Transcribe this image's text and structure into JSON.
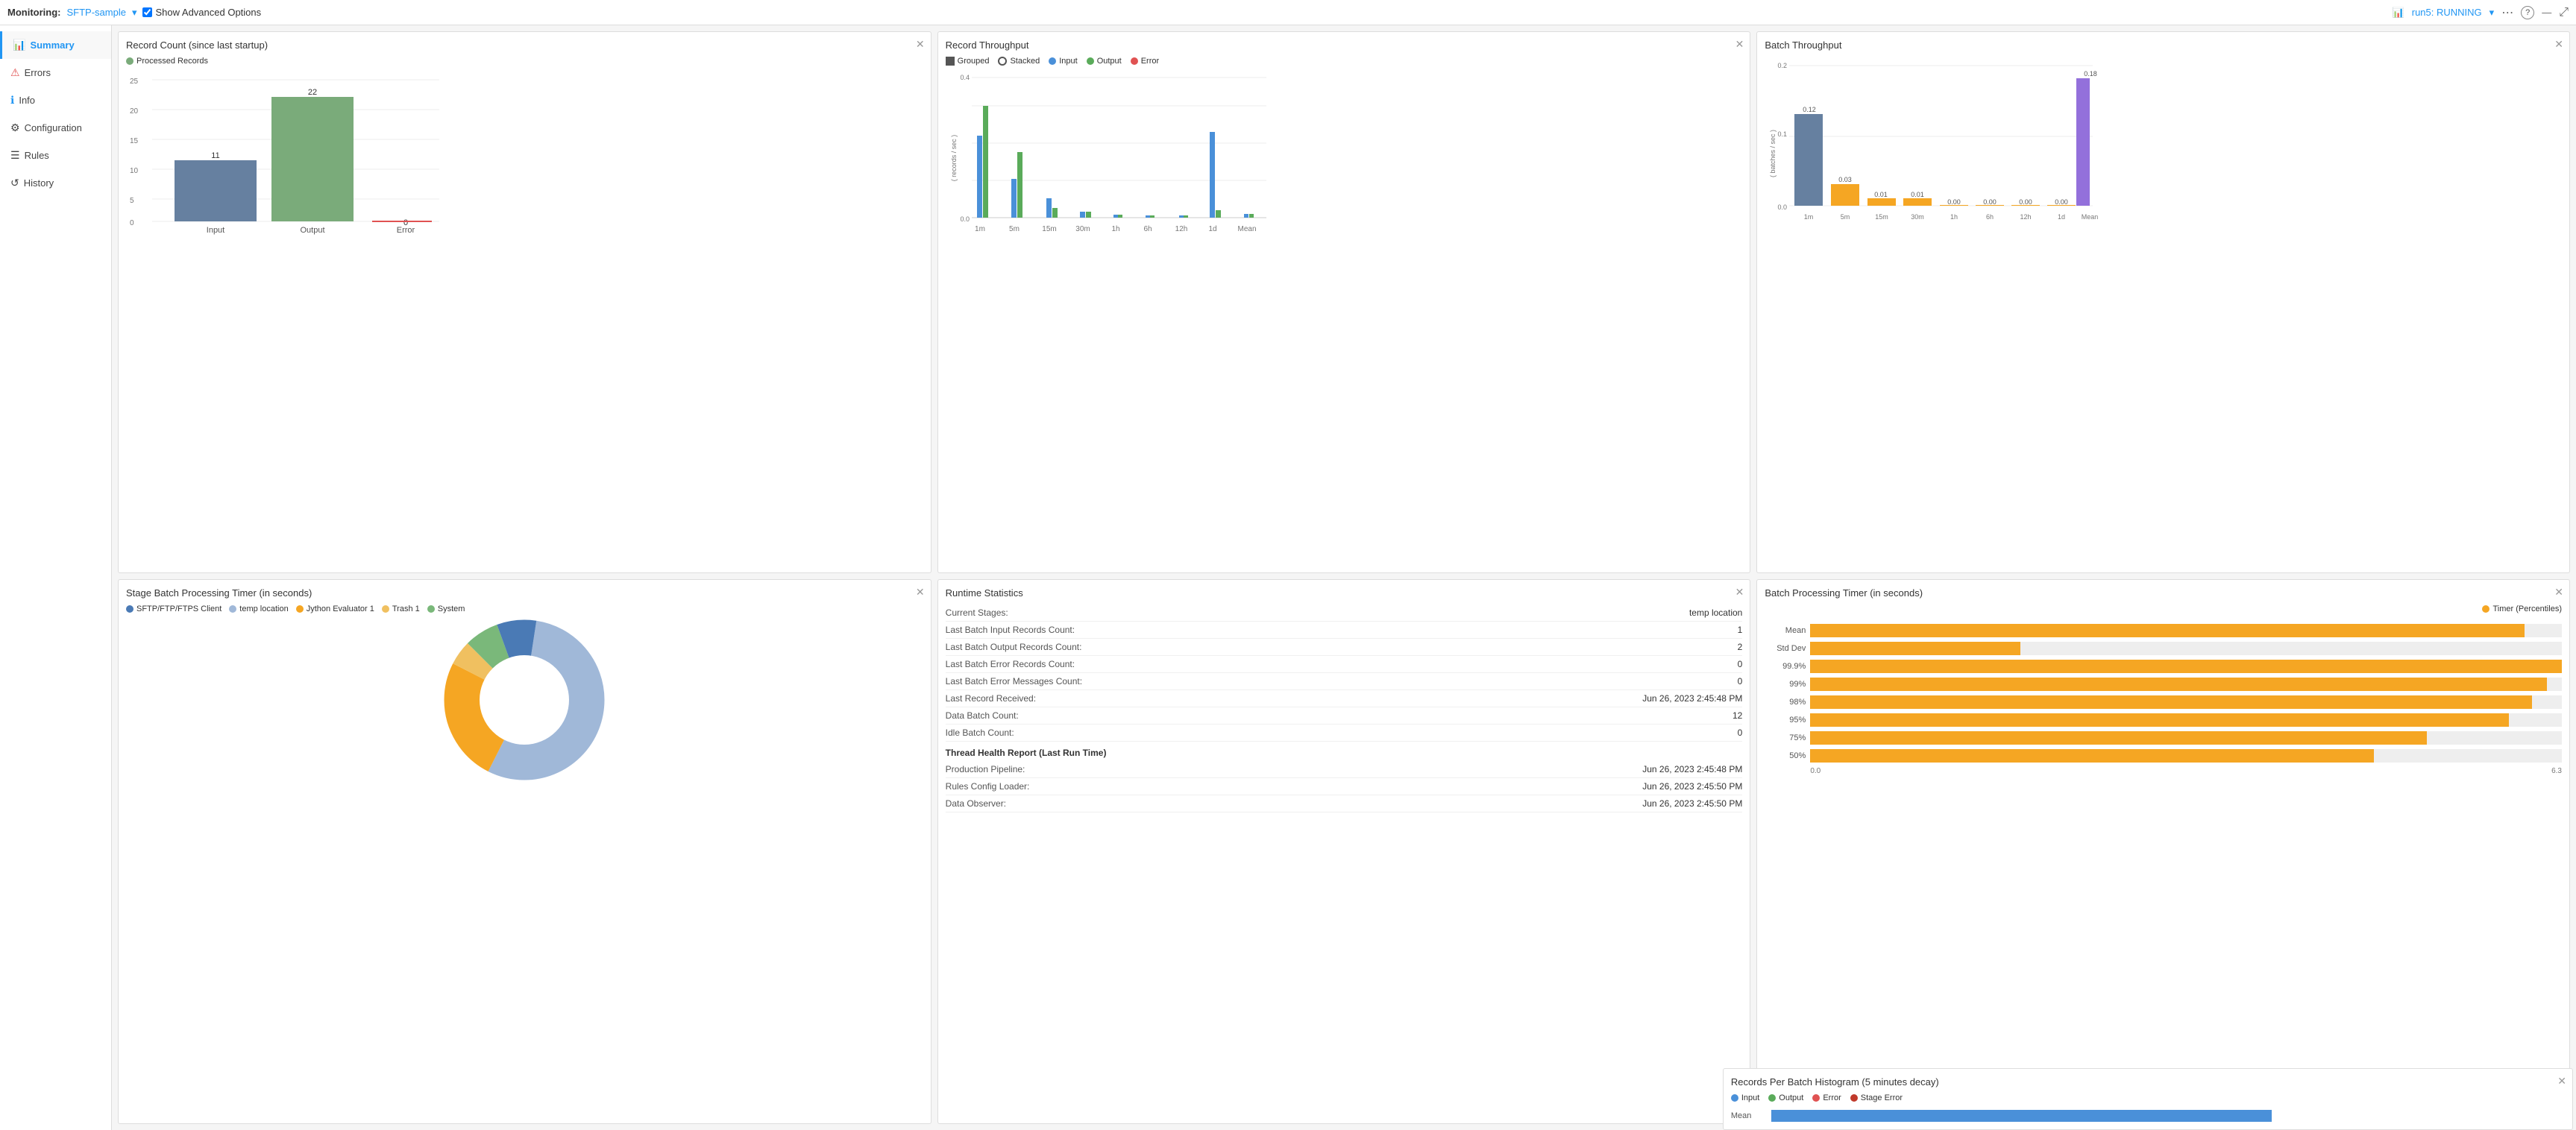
{
  "topbar": {
    "monitoring": "Monitoring:",
    "sftp_label": "SFTP-sample",
    "show_advanced": "Show Advanced Options",
    "run_label": "run5: RUNNING",
    "more_icon": "⋯",
    "help_icon": "?",
    "minimize_icon": "—",
    "maximize_icon": "⤢"
  },
  "sidebar": {
    "items": [
      {
        "id": "summary",
        "label": "Summary",
        "icon": "📊",
        "active": true
      },
      {
        "id": "errors",
        "label": "Errors",
        "icon": "⚠",
        "active": false
      },
      {
        "id": "info",
        "label": "Info",
        "icon": "ℹ",
        "active": false
      },
      {
        "id": "configuration",
        "label": "Configuration",
        "icon": "⚙",
        "active": false
      },
      {
        "id": "rules",
        "label": "Rules",
        "icon": "☰",
        "active": false
      },
      {
        "id": "history",
        "label": "History",
        "icon": "↺",
        "active": false
      }
    ]
  },
  "panels": {
    "record_count": {
      "title": "Record Count (since last startup)",
      "legend": [
        {
          "label": "Processed Records",
          "color": "#5b8a5b"
        }
      ],
      "bars": [
        {
          "label": "Input",
          "value": 11,
          "color": "#6680a0"
        },
        {
          "label": "Output",
          "value": 22,
          "color": "#7aab7a"
        },
        {
          "label": "Error",
          "value": 0,
          "color": "#e05252"
        }
      ]
    },
    "record_throughput": {
      "title": "Record Throughput",
      "y_label": "( records / sec )",
      "legend": [
        {
          "label": "Grouped",
          "type": "filled",
          "color": "#555"
        },
        {
          "label": "Stacked",
          "type": "circle",
          "color": "#555"
        },
        {
          "label": "Input",
          "type": "dot",
          "color": "#4a90d9"
        },
        {
          "label": "Output",
          "type": "dot",
          "color": "#5aab5a"
        },
        {
          "label": "Error",
          "type": "dot",
          "color": "#e05252"
        }
      ],
      "x_labels": [
        "1m",
        "5m",
        "15m",
        "30m",
        "1h",
        "6h",
        "12h",
        "1d",
        "Mean"
      ],
      "y_labels": [
        "0.4",
        "0.0"
      ],
      "data": [
        {
          "x": "1m",
          "input": 55,
          "output": 75
        },
        {
          "x": "5m",
          "input": 20,
          "output": 35
        },
        {
          "x": "15m",
          "input": 10,
          "output": 5
        },
        {
          "x": "30m",
          "input": 3,
          "output": 3
        },
        {
          "x": "1h",
          "input": 2,
          "output": 2
        },
        {
          "x": "6h",
          "input": 1,
          "output": 1
        },
        {
          "x": "12h",
          "input": 1,
          "output": 1
        },
        {
          "x": "1d",
          "input": 45,
          "output": 5
        },
        {
          "x": "Mean",
          "input": 2,
          "output": 2
        }
      ]
    },
    "batch_throughput": {
      "title": "Batch Throughput",
      "y_label": "( batches / sec )",
      "x_labels": [
        "1m",
        "5m",
        "15m",
        "30m",
        "1h",
        "6h",
        "12h",
        "1d",
        "Mean"
      ],
      "values": [
        {
          "x": "1m",
          "v": 0.12,
          "h": 85
        },
        {
          "x": "5m",
          "v": 0.03,
          "h": 21
        },
        {
          "x": "15m",
          "v": 0.01,
          "h": 7
        },
        {
          "x": "30m",
          "v": 0.01,
          "h": 7
        },
        {
          "x": "1h",
          "v": 0.0,
          "h": 1
        },
        {
          "x": "6h",
          "v": 0.0,
          "h": 1
        },
        {
          "x": "12h",
          "v": 0.0,
          "h": 1
        },
        {
          "x": "1d",
          "v": 0.0,
          "h": 1
        },
        {
          "x": "Mean",
          "v": 0.18,
          "h": 127
        }
      ],
      "y_max": "0.2",
      "y_labels": [
        "0.2",
        "0.1",
        "0.0"
      ]
    },
    "stage_batch": {
      "title": "Stage Batch Processing Timer (in seconds)",
      "legend": [
        {
          "label": "SFTP/FTP/FTPS Client",
          "color": "#4a7ab5"
        },
        {
          "label": "temp location",
          "color": "#a0b8d8"
        },
        {
          "label": "Jython Evaluator 1",
          "color": "#f5a623"
        },
        {
          "label": "Trash 1",
          "color": "#f0c060"
        },
        {
          "label": "System",
          "color": "#7ab87a"
        }
      ],
      "donut": {
        "segments": [
          {
            "label": "SFTP/FTP/FTPS Client",
            "color": "#4a7ab5",
            "pct": 8
          },
          {
            "label": "temp location",
            "color": "#a0b8d8",
            "pct": 55
          },
          {
            "label": "Jython Evaluator 1",
            "color": "#f5a623",
            "pct": 25
          },
          {
            "label": "Trash 1",
            "color": "#f0c060",
            "pct": 5
          },
          {
            "label": "System",
            "color": "#7ab87a",
            "pct": 7
          }
        ]
      }
    },
    "runtime_stats": {
      "title": "Runtime Statistics",
      "rows": [
        {
          "label": "Current Stages:",
          "value": "temp location"
        },
        {
          "label": "Last Batch Input Records Count:",
          "value": "1"
        },
        {
          "label": "Last Batch Output Records Count:",
          "value": "2"
        },
        {
          "label": "Last Batch Error Records Count:",
          "value": "0"
        },
        {
          "label": "Last Batch Error Messages Count:",
          "value": "0"
        },
        {
          "label": "Last Record Received:",
          "value": "Jun 26, 2023 2:45:48 PM"
        },
        {
          "label": "Data Batch Count:",
          "value": "12"
        },
        {
          "label": "Idle Batch Count:",
          "value": "0"
        }
      ],
      "health_title": "Thread Health Report (Last Run Time)",
      "health_rows": [
        {
          "label": "Production Pipeline:",
          "value": "Jun 26, 2023 2:45:48 PM"
        },
        {
          "label": "Rules Config Loader:",
          "value": "Jun 26, 2023 2:45:50 PM"
        },
        {
          "label": "Data Observer:",
          "value": "Jun 26, 2023 2:45:50 PM"
        }
      ]
    },
    "batch_processing_timer": {
      "title": "Batch Processing Timer (in seconds)",
      "legend": [
        {
          "label": "Timer (Percentiles)",
          "color": "#f5a623"
        }
      ],
      "x_max": "6.3",
      "x_min": "0.0",
      "rows": [
        {
          "label": "Mean",
          "pct": 95
        },
        {
          "label": "Std Dev",
          "pct": 28
        },
        {
          "label": "99.9%",
          "pct": 100
        },
        {
          "label": "99%",
          "pct": 98
        },
        {
          "label": "98%",
          "pct": 96
        },
        {
          "label": "95%",
          "pct": 93
        },
        {
          "label": "75%",
          "pct": 82
        },
        {
          "label": "50%",
          "pct": 75
        }
      ]
    },
    "records_per_batch": {
      "title": "Records Per Batch Histogram (5 minutes decay)",
      "legend": [
        {
          "label": "Input",
          "color": "#4a90d9"
        },
        {
          "label": "Output",
          "color": "#5aab5a"
        },
        {
          "label": "Error",
          "color": "#e05252"
        },
        {
          "label": "Stage Error",
          "color": "#c0392b"
        }
      ],
      "row_label": "Mean"
    }
  }
}
